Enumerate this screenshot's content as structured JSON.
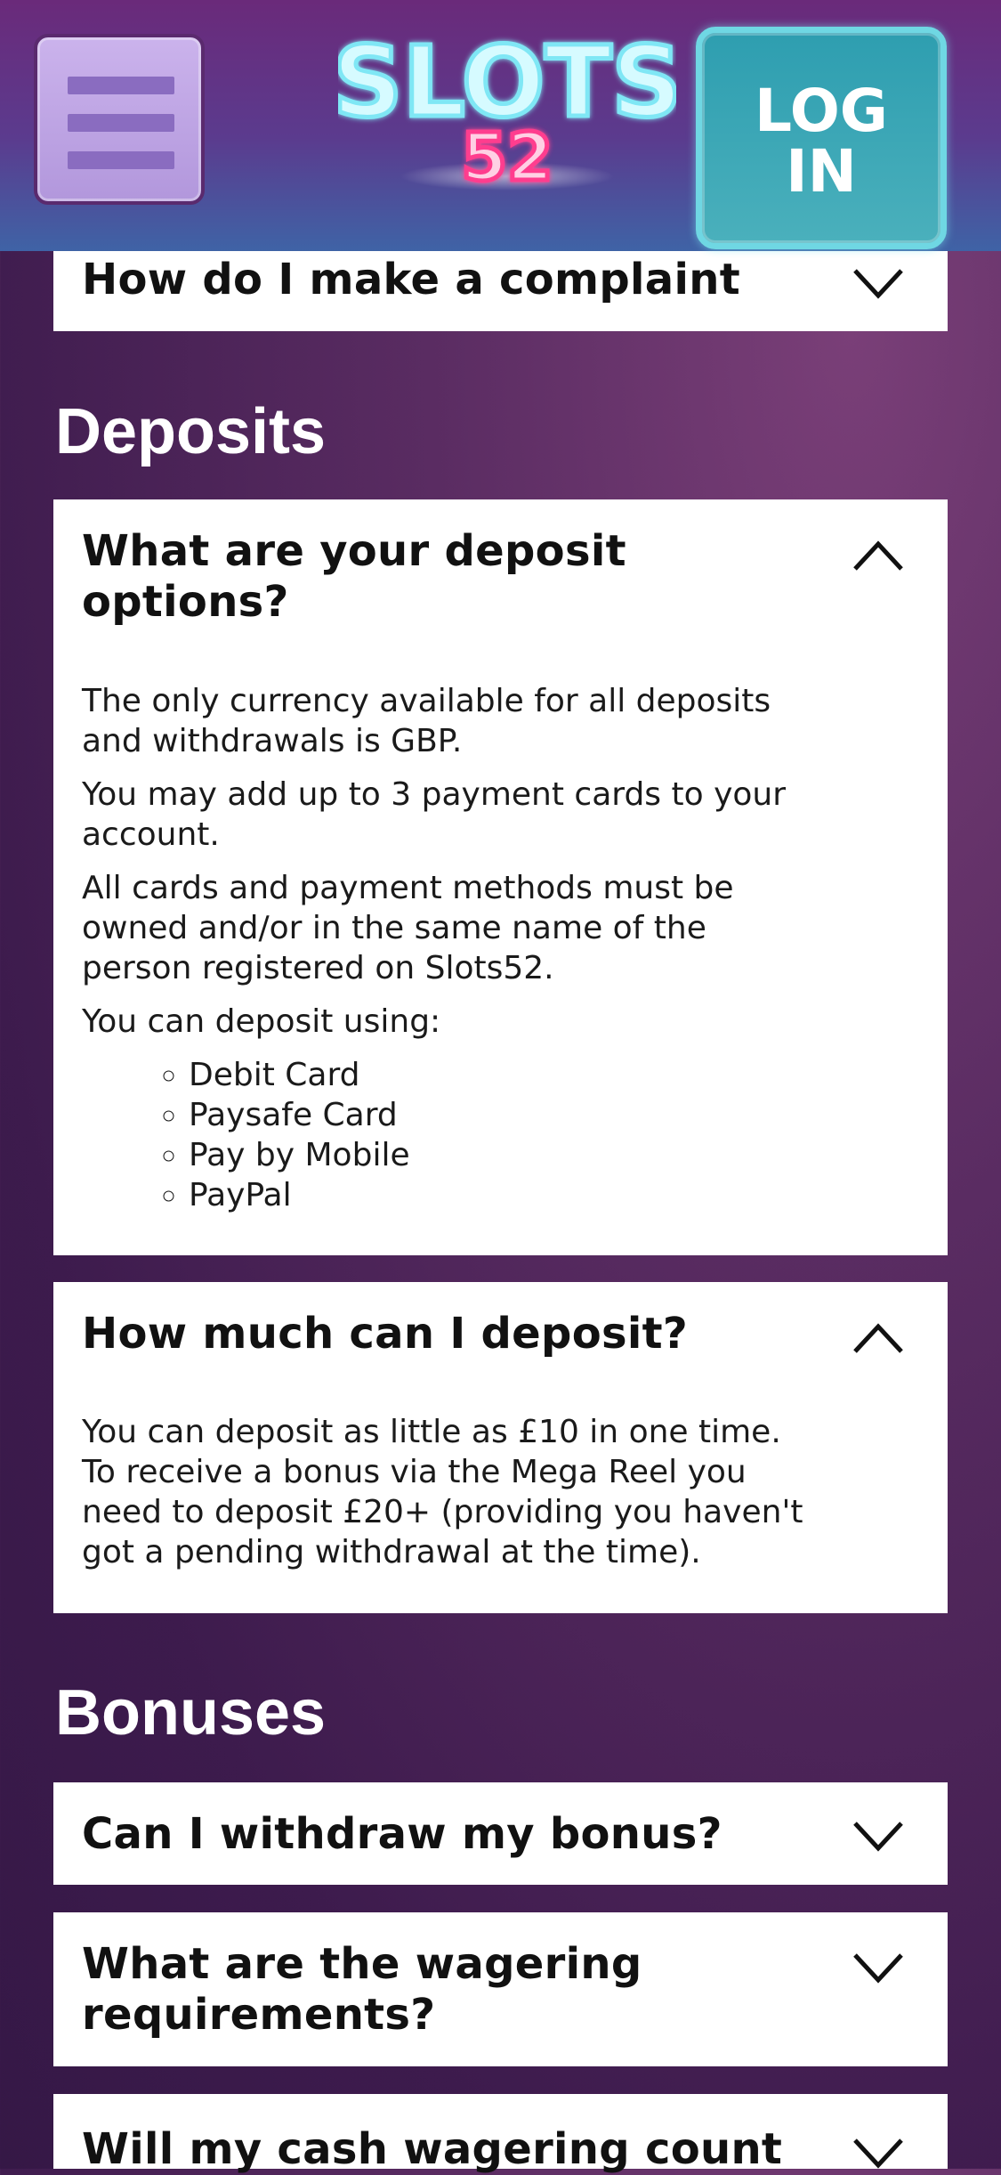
{
  "header": {
    "logo_text": "SLOTS",
    "logo_number": "52",
    "login_label_line1": "LOG",
    "login_label_line2": "IN"
  },
  "faq": {
    "complaint": {
      "question": "How do I make a complaint"
    },
    "deposits": {
      "heading": "Deposits",
      "options": {
        "question": "What are your deposit options?",
        "paragraphs": [
          "The only currency available for all deposits and withdrawals is GBP.",
          "You may add up to 3 payment cards to your account.",
          "All cards and payment methods must be owned and/or in the same name of the person registered on Slots52.",
          "You can deposit using:"
        ],
        "methods": [
          "Debit Card",
          "Paysafe Card",
          "Pay by Mobile",
          "PayPal"
        ]
      },
      "amount": {
        "question": "How much can I deposit?",
        "answer": "You can deposit as little as £10 in one time. To receive a bonus via the Mega Reel you need to deposit £20+ (providing you haven't got a pending withdrawal at the time)."
      }
    },
    "bonuses": {
      "heading": "Bonuses",
      "items": [
        {
          "question": "Can I withdraw my bonus?"
        },
        {
          "question": "What are the wagering requirements?"
        },
        {
          "question": "Will my cash wagering count"
        }
      ]
    }
  },
  "colors": {
    "login_teal": "#3aa7b5",
    "menu_lavender": "#c2a8e6",
    "logo_neon_blue": "#9ff0ff",
    "logo_neon_pink": "#ff3c8e"
  }
}
